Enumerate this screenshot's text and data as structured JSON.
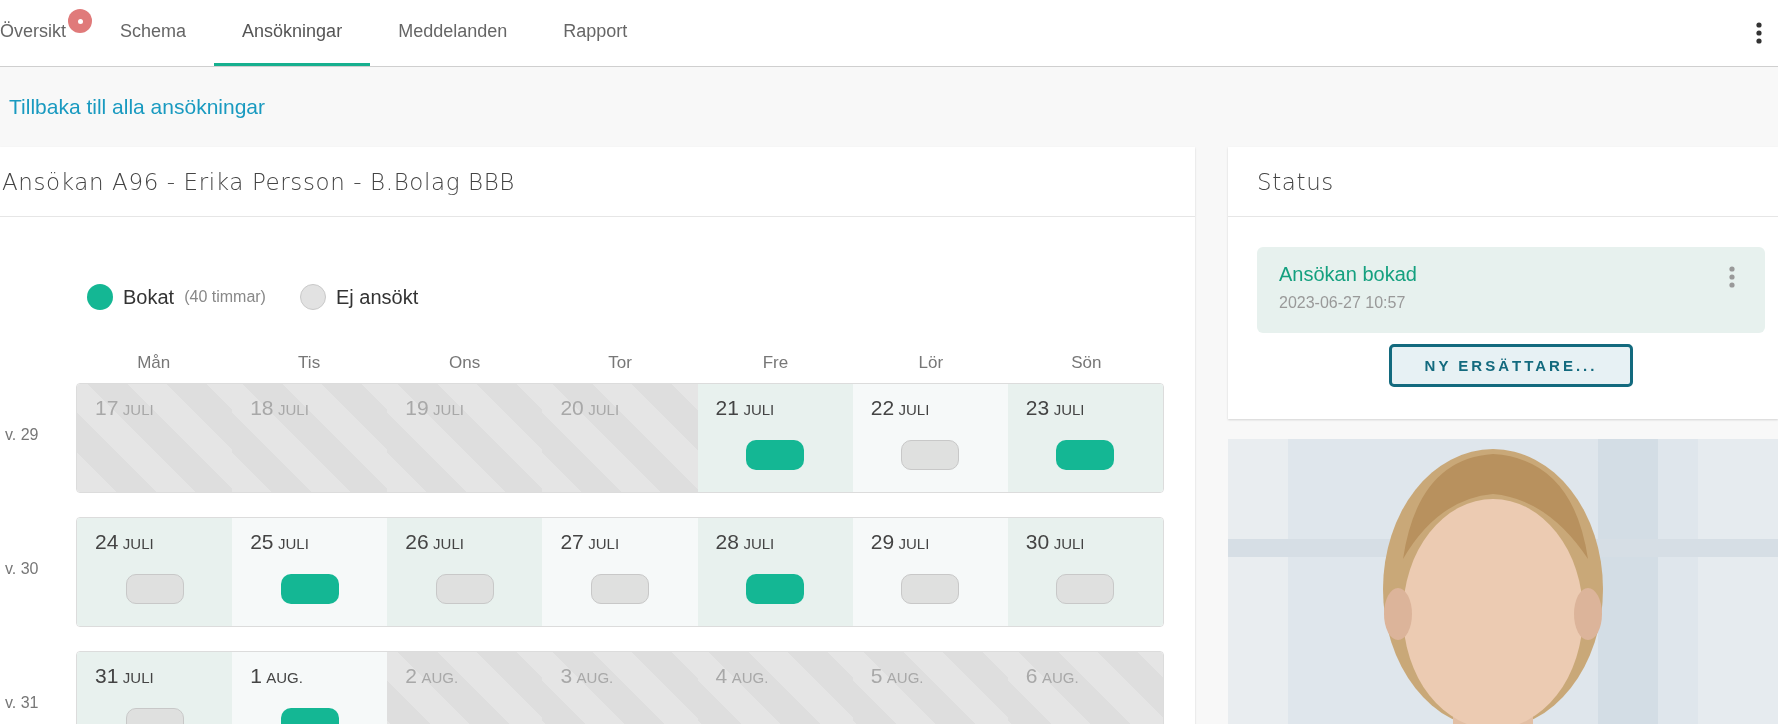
{
  "tabs": [
    {
      "label": "Översikt",
      "selected": false,
      "badge": true
    },
    {
      "label": "Schema",
      "selected": false,
      "badge": false
    },
    {
      "label": "Ansökningar",
      "selected": true,
      "badge": false
    },
    {
      "label": "Meddelanden",
      "selected": false,
      "badge": false
    },
    {
      "label": "Rapport",
      "selected": false,
      "badge": false
    }
  ],
  "back_link": "Tillbaka till alla ansökningar",
  "application": {
    "title": "Ansökan A96 - Erika Persson - B.Bolag BBB",
    "legend": [
      {
        "kind": "booked",
        "label": "Bokat",
        "note": "(40 timmar)"
      },
      {
        "kind": "not_applied",
        "label": "Ej ansökt"
      }
    ],
    "weekdays": [
      "Mån",
      "Tis",
      "Ons",
      "Tor",
      "Fre",
      "Lör",
      "Sön"
    ],
    "weeks": [
      {
        "label": "v. 29",
        "days": [
          {
            "day": "17",
            "month": "JULI",
            "kind": "unavailable"
          },
          {
            "day": "18",
            "month": "JULI",
            "kind": "unavailable"
          },
          {
            "day": "19",
            "month": "JULI",
            "kind": "unavailable"
          },
          {
            "day": "20",
            "month": "JULI",
            "kind": "unavailable"
          },
          {
            "day": "21",
            "month": "JULI",
            "kind": "booked"
          },
          {
            "day": "22",
            "month": "JULI",
            "kind": "not_applied"
          },
          {
            "day": "23",
            "month": "JULI",
            "kind": "booked"
          }
        ]
      },
      {
        "label": "v. 30",
        "days": [
          {
            "day": "24",
            "month": "JULI",
            "kind": "not_applied"
          },
          {
            "day": "25",
            "month": "JULI",
            "kind": "booked"
          },
          {
            "day": "26",
            "month": "JULI",
            "kind": "not_applied"
          },
          {
            "day": "27",
            "month": "JULI",
            "kind": "not_applied"
          },
          {
            "day": "28",
            "month": "JULI",
            "kind": "booked"
          },
          {
            "day": "29",
            "month": "JULI",
            "kind": "not_applied"
          },
          {
            "day": "30",
            "month": "JULI",
            "kind": "not_applied"
          }
        ]
      },
      {
        "label": "v. 31",
        "days": [
          {
            "day": "31",
            "month": "JULI",
            "kind": "not_applied"
          },
          {
            "day": "1",
            "month": "AUG.",
            "kind": "booked"
          },
          {
            "day": "2",
            "month": "AUG.",
            "kind": "unavailable"
          },
          {
            "day": "3",
            "month": "AUG.",
            "kind": "unavailable"
          },
          {
            "day": "4",
            "month": "AUG.",
            "kind": "unavailable"
          },
          {
            "day": "5",
            "month": "AUG.",
            "kind": "unavailable"
          },
          {
            "day": "6",
            "month": "AUG.",
            "kind": "unavailable"
          }
        ]
      }
    ]
  },
  "status": {
    "title": "Status",
    "events": [
      {
        "title": "Ansökan bokad",
        "time": "2023-06-27 10:57"
      }
    ],
    "button": "NY ERSÄTTARE..."
  }
}
